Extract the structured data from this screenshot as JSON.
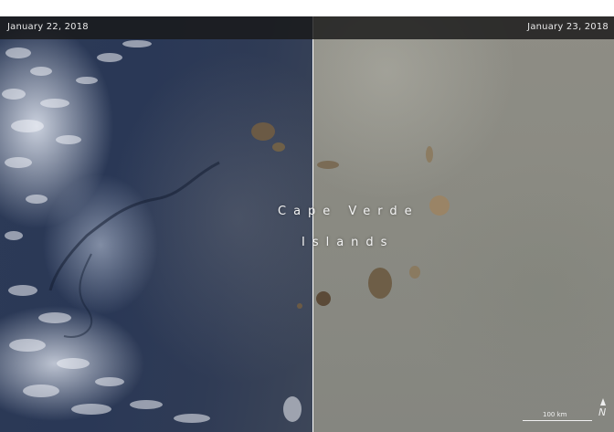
{
  "image": {
    "date_left": "January 22, 2018",
    "date_right": "January 23, 2018",
    "label_line1": "Cape Verde",
    "label_line2": "Islands",
    "scale_text": "100 km",
    "north_symbol": "N",
    "north_icon": "north-arrow-icon"
  }
}
